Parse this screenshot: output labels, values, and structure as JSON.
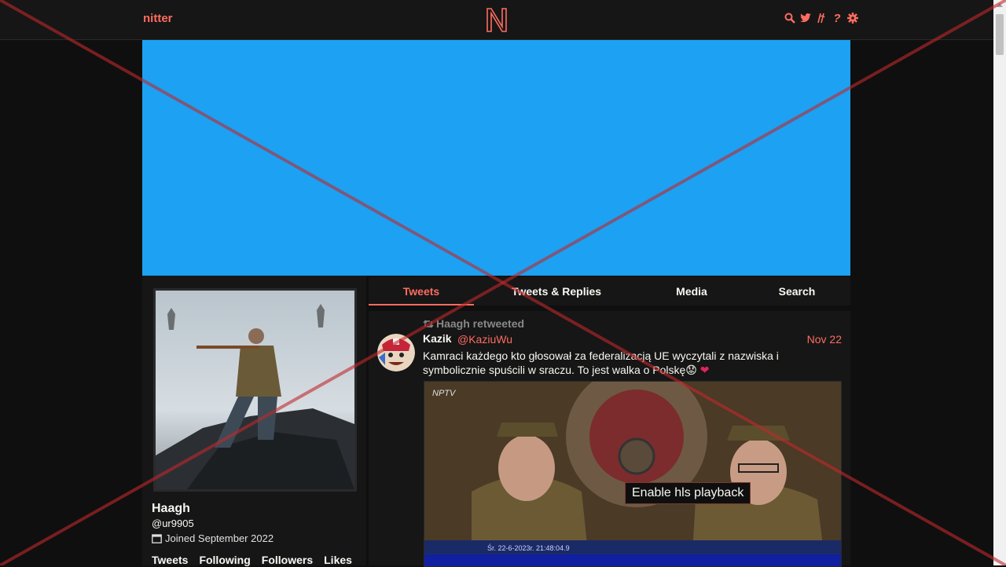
{
  "navbar": {
    "brand": "nitter",
    "logo_letter": "N",
    "icons": [
      "search-icon",
      "twitter-icon",
      "rss-icon",
      "help-icon",
      "settings-icon"
    ],
    "help_glyph": "?"
  },
  "colors": {
    "accent": "#ff6c60",
    "background": "#0f0f0f",
    "panel": "#161616",
    "banner": "#1da1f2",
    "overlay_x": "#c0282c"
  },
  "profile": {
    "name": "Haagh",
    "handle": "@ur9905",
    "joined": "Joined September 2022",
    "stats": [
      "Tweets",
      "Following",
      "Followers",
      "Likes"
    ]
  },
  "tabs": [
    "Tweets",
    "Tweets & Replies",
    "Media",
    "Search"
  ],
  "tweet": {
    "retweet_header": "Haagh retweeted",
    "name": "Kazik",
    "username": "@KaziuWu",
    "date": "Nov 22",
    "text": "Kamraci każdego kto głosował za federalizacją UE wyczytali z nazwiska i symbolicznie spuścili w sraczu. To jest walka o Polskę😟",
    "heart": "❤",
    "video_channel": "NPTV",
    "video_timestamp": "Śr. 22-6-2023r. 21:48:04.9",
    "video_button": "Enable hls playback"
  }
}
